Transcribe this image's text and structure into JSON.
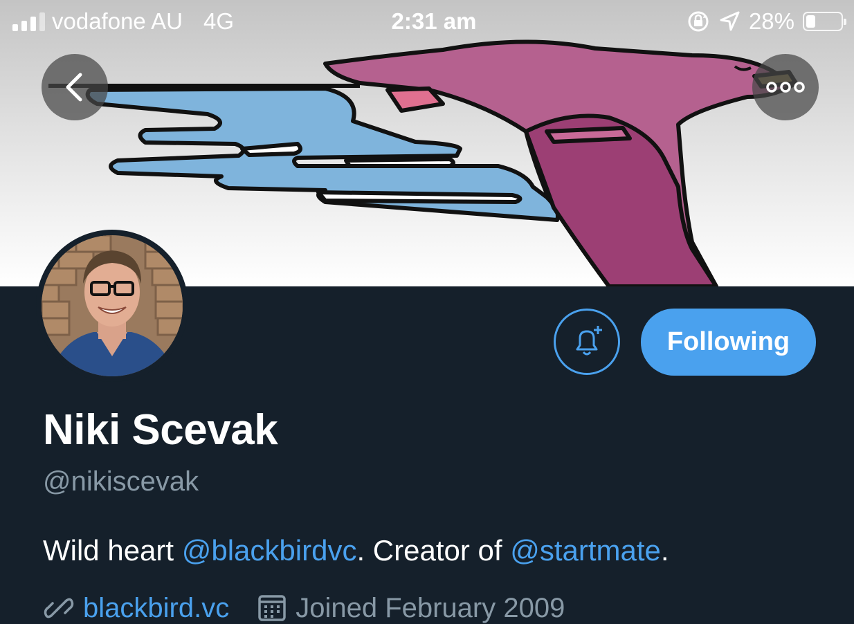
{
  "status_bar": {
    "carrier": "vodafone AU",
    "network": "4G",
    "time": "2:31 am",
    "battery_percent": "28%",
    "battery_level": 0.28
  },
  "header": {
    "back_icon": "chevron-left-icon",
    "more_icon": "more-dots-icon"
  },
  "profile": {
    "display_name": "Niki Scevak",
    "handle": "@nikiscevak",
    "bio": {
      "part1": "Wild heart ",
      "mention1": "@blackbirdvc",
      "part2": ". Creator of ",
      "mention2": "@startmate",
      "part3": "."
    },
    "website": "blackbird.vc",
    "joined": "Joined February 2009"
  },
  "actions": {
    "notifications_icon": "bell-plus-icon",
    "follow_label": "Following"
  },
  "colors": {
    "background": "#15202b",
    "accent": "#4aa1ee",
    "secondary_text": "#8899a6",
    "bird": "#b5618f",
    "cloud": "#7fb4dc"
  }
}
